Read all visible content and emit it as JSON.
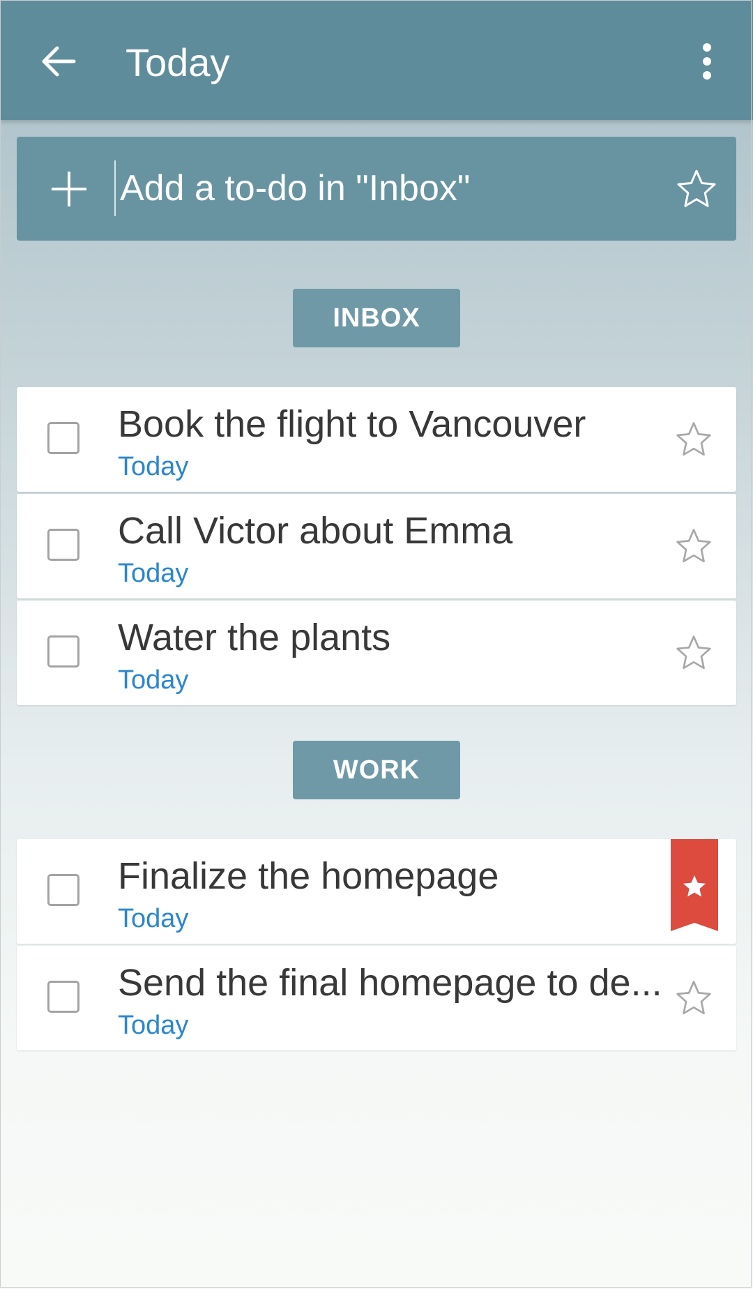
{
  "appbar": {
    "title": "Today",
    "back_icon": "arrow-left-icon",
    "overflow_icon": "more-vert-icon"
  },
  "add_bar": {
    "placeholder": "Add a to-do in \"Inbox\"",
    "value": "",
    "add_icon": "plus-icon",
    "star_icon": "star-outline-icon"
  },
  "sections": [
    {
      "label": "INBOX",
      "tasks": [
        {
          "title": "Book the flight to Vancouver",
          "due": "Today",
          "starred": false
        },
        {
          "title": "Call Victor about Emma",
          "due": "Today",
          "starred": false
        },
        {
          "title": "Water the plants",
          "due": "Today",
          "starred": false
        }
      ]
    },
    {
      "label": "WORK",
      "tasks": [
        {
          "title": "Finalize the homepage",
          "due": "Today",
          "starred": true
        },
        {
          "title": "Send the final homepage to de...",
          "due": "Today",
          "starred": false
        }
      ]
    }
  ],
  "colors": {
    "appbar": "#5f8c9b",
    "add_bar": "#6894a2",
    "section_header": "#6f99a7",
    "due_text": "#2b86cf",
    "ribbon": "#dc4b3e"
  }
}
